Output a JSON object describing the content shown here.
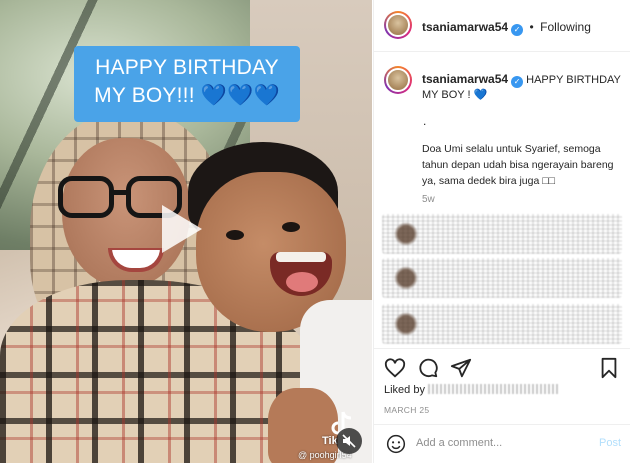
{
  "post": {
    "username": "tsaniamarwa54",
    "verified": true,
    "follow_separator": "•",
    "follow_label": "Following",
    "caption_title": "HAPPY BIRTHDAY MY BOY !",
    "caption_heart": "💙",
    "bullet": ".",
    "body": "Doa Umi selalu untuk Syarief, semoga tahun depan udah bisa ngerayain bareng ya, sama dedek bira juga □□",
    "time_ago": "5w",
    "likes_prefix": "Liked by",
    "date": "MARCH 25",
    "comment_placeholder": "Add a comment...",
    "post_label": "Post"
  },
  "media": {
    "overlay_line1": "HAPPY BIRTHDAY",
    "overlay_line2": "MY BOY!!!",
    "overlay_hearts": "💙💙💙",
    "tiktok_label": "Tik",
    "tiktok_user": "@ poohgirl54"
  },
  "colors": {
    "caption_box": "#4aa3e8",
    "verified": "#3897f0",
    "post_button": "#b2dffc"
  },
  "icons": [
    "play-icon",
    "tiktok-icon",
    "mute-icon",
    "heart-icon",
    "comment-icon",
    "share-icon",
    "bookmark-icon",
    "emoji-icon",
    "verified-icon"
  ]
}
